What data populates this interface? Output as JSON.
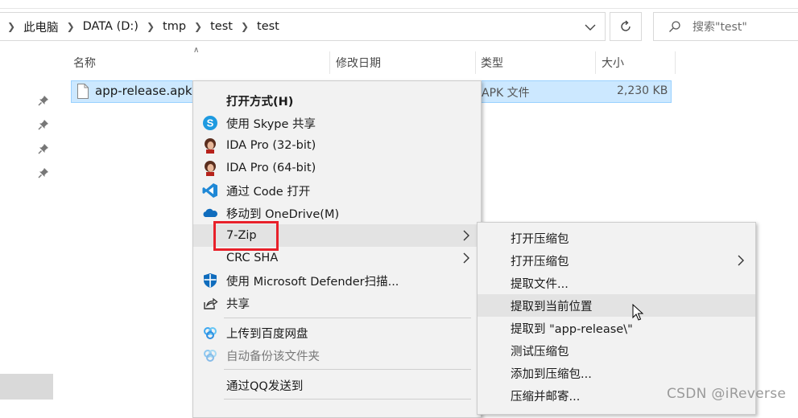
{
  "breadcrumbs": [
    "此电脑",
    "DATA (D:)",
    "tmp",
    "test",
    "test"
  ],
  "search": {
    "placeholder": "搜索\"test\""
  },
  "columns": {
    "name": "名称",
    "modified": "修改日期",
    "type": "类型",
    "size": "大小"
  },
  "file": {
    "name": "app-release.apk",
    "type": "APK 文件",
    "size": "2,230 KB"
  },
  "context_menu": [
    {
      "label": "打开方式(H)",
      "icon": "none",
      "bold": true
    },
    {
      "label": "使用 Skype 共享",
      "icon": "skype-icon"
    },
    {
      "label": "IDA Pro (32-bit)",
      "icon": "ida-pro-icon"
    },
    {
      "label": "IDA Pro (64-bit)",
      "icon": "ida-pro-icon"
    },
    {
      "label": "通过 Code 打开",
      "icon": "vscode-icon"
    },
    {
      "label": "移动到 OneDrive(M)",
      "icon": "onedrive-icon"
    },
    {
      "label": "7-Zip",
      "icon": "none",
      "submenu": true,
      "hover": true
    },
    {
      "label": "CRC SHA",
      "icon": "none",
      "submenu": true
    },
    {
      "label": "使用 Microsoft Defender扫描...",
      "icon": "defender-icon"
    },
    {
      "label": "共享",
      "icon": "share-icon"
    },
    {
      "label": "上传到百度网盘",
      "icon": "baidu-netdisk-icon"
    },
    {
      "label": "自动备份该文件夹",
      "icon": "baidu-netdisk-icon",
      "disabled": true
    },
    {
      "label": "通过QQ发送到",
      "icon": "none"
    }
  ],
  "submenu_7zip": [
    {
      "label": "打开压缩包"
    },
    {
      "label": "打开压缩包",
      "submenu": true
    },
    {
      "label": "提取文件..."
    },
    {
      "label": "提取到当前位置",
      "hover": true
    },
    {
      "label": "提取到 \"app-release\\\""
    },
    {
      "label": "测试压缩包"
    },
    {
      "label": "添加到压缩包..."
    },
    {
      "label": "压缩并邮寄..."
    }
  ],
  "watermark": "CSDN @iReverse",
  "colors": {
    "selection": "#cce8ff",
    "highlight_box": "#e8202a",
    "menu_bg": "#f2f2f2"
  }
}
